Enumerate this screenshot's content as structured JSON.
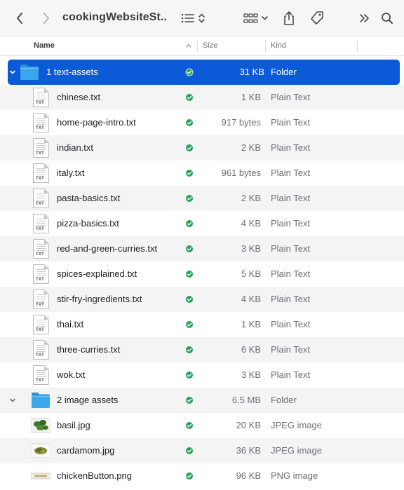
{
  "window": {
    "title": "cookingWebsiteSt..."
  },
  "columns": {
    "name": "Name",
    "size": "Size",
    "kind": "Kind"
  },
  "colors": {
    "selection": "#0b5bd8",
    "folder": "#3aa6ec",
    "status_green": "#28a05a"
  },
  "rows": [
    {
      "name": "1 text-assets",
      "size": "31 KB",
      "kind": "Folder",
      "icon": "folder-icon",
      "expanded": true,
      "selected": true
    },
    {
      "name": "chinese.txt",
      "size": "1 KB",
      "kind": "Plain Text",
      "icon": "text-file-icon"
    },
    {
      "name": "home-page-intro.txt",
      "size": "917 bytes",
      "kind": "Plain Text",
      "icon": "text-file-icon"
    },
    {
      "name": "indian.txt",
      "size": "2 KB",
      "kind": "Plain Text",
      "icon": "text-file-icon"
    },
    {
      "name": "italy.txt",
      "size": "961 bytes",
      "kind": "Plain Text",
      "icon": "text-file-icon"
    },
    {
      "name": "pasta-basics.txt",
      "size": "2 KB",
      "kind": "Plain Text",
      "icon": "text-file-icon"
    },
    {
      "name": "pizza-basics.txt",
      "size": "4 KB",
      "kind": "Plain Text",
      "icon": "text-file-icon"
    },
    {
      "name": "red-and-green-curries.txt",
      "size": "3 KB",
      "kind": "Plain Text",
      "icon": "text-file-icon"
    },
    {
      "name": "spices-explained.txt",
      "size": "5 KB",
      "kind": "Plain Text",
      "icon": "text-file-icon"
    },
    {
      "name": "stir-fry-ingredients.txt",
      "size": "4 KB",
      "kind": "Plain Text",
      "icon": "text-file-icon"
    },
    {
      "name": "thai.txt",
      "size": "1 KB",
      "kind": "Plain Text",
      "icon": "text-file-icon"
    },
    {
      "name": "three-curries.txt",
      "size": "6 KB",
      "kind": "Plain Text",
      "icon": "text-file-icon"
    },
    {
      "name": "wok.txt",
      "size": "3 KB",
      "kind": "Plain Text",
      "icon": "text-file-icon"
    },
    {
      "name": "2 image assets",
      "size": "6.5 MB",
      "kind": "Folder",
      "icon": "folder-icon",
      "expanded": true
    },
    {
      "name": "basil.jpg",
      "size": "20 KB",
      "kind": "JPEG image",
      "icon": "basil-thumbnail"
    },
    {
      "name": "cardamom.jpg",
      "size": "36 KB",
      "kind": "JPEG image",
      "icon": "cardamom-thumbnail"
    },
    {
      "name": "chickenButton.png",
      "size": "96 KB",
      "kind": "PNG image",
      "icon": "button-thumbnail"
    }
  ],
  "status_tag": "TXT"
}
